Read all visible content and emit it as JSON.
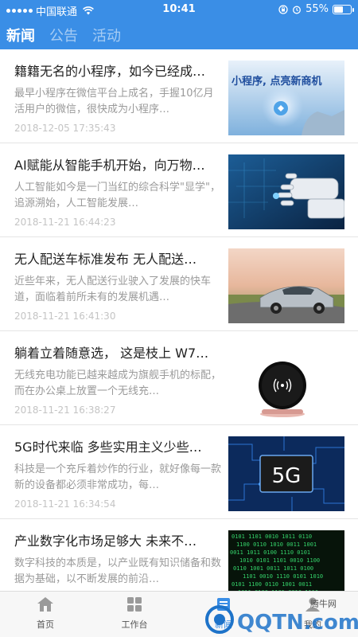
{
  "status_bar": {
    "carrier": "中国联通",
    "time": "10:41",
    "battery": "55%",
    "battery_level": 0.55
  },
  "header": {
    "tabs": [
      "新闻",
      "公告",
      "活动"
    ],
    "active_tab": 0
  },
  "news": [
    {
      "title": "籍籍无名的小程序，如今已经成…",
      "summary": "最早小程序在微信平台上成名，手握10亿月活用户的微信，很快成为小程序…",
      "date": "2018-12-05 17:35:43",
      "thumb_text": "小程序, 点亮新商机"
    },
    {
      "title": "AI赋能从智能手机开始，向万物…",
      "summary": "人工智能如今是一门当红的综合科学\"显学\"，追源溯始，人工智能发展…",
      "date": "2018-11-21 16:44:23",
      "thumb_text": ""
    },
    {
      "title": "无人配送车标准发布 无人配送…",
      "summary": "近些年来，无人配送行业驶入了发展的快车道，面临着前所未有的发展机遇…",
      "date": "2018-11-21 16:41:30",
      "thumb_text": ""
    },
    {
      "title": "躺着立着随意选， 这是枝上 W7…",
      "summary": "无线充电功能已越来越成为旗舰手机的标配，而在办公桌上放置一个无线充…",
      "date": "2018-11-21 16:38:27",
      "thumb_text": ""
    },
    {
      "title": "5G时代来临 多些实用主义少些…",
      "summary": "科技是一个充斥着炒作的行业，就好像每一款新的设备都必须非常成功，每…",
      "date": "2018-11-21 16:34:54",
      "thumb_text": "5G"
    },
    {
      "title": "产业数字化市场足够大 未来不…",
      "summary": "数字科技的本质是，以产业既有知识储备和数据为基础，以不断发展的前沿…",
      "date": "",
      "thumb_text": ""
    }
  ],
  "tabbar": {
    "items": [
      "首页",
      "工作台",
      "新闻",
      "我的"
    ],
    "active": 2
  },
  "watermark": {
    "brand": "腾牛网",
    "logo_text": "QQTN.com"
  },
  "colors": {
    "primary": "#3a8ee6",
    "title": "#222222",
    "summary": "#9a9a9a",
    "date": "#c4c4c4"
  }
}
